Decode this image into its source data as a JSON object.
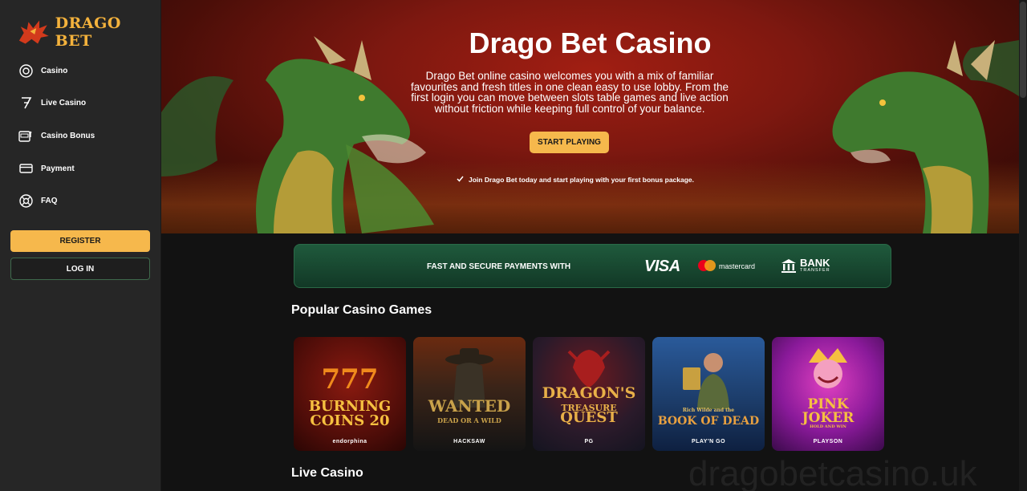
{
  "brand": {
    "name": "DRAGO BET",
    "accent": "#f6b84c",
    "logo_color": "#f4b23c"
  },
  "sidebar": {
    "items": [
      {
        "label": "Casino",
        "icon": "casino-chip-icon"
      },
      {
        "label": "Live Casino",
        "icon": "seven-icon"
      },
      {
        "label": "Casino Bonus",
        "icon": "slot-machine-icon"
      },
      {
        "label": "Payment",
        "icon": "card-icon"
      },
      {
        "label": "FAQ",
        "icon": "lifebuoy-icon"
      }
    ],
    "register_label": "REGISTER",
    "login_label": "LOG IN"
  },
  "hero": {
    "title": "Drago Bet Casino",
    "description": "Drago Bet online casino welcomes you with a mix of familiar favourites and fresh titles in one clean easy to use lobby. From the first login you can move between slots table games and live action without friction while keeping full control of your balance.",
    "cta_label": "START PLAYING",
    "note": "Join Drago Bet today and start playing with your first bonus package."
  },
  "payments": {
    "label": "FAST AND SECURE PAYMENTS WITH",
    "visa": "VISA",
    "mastercard": "mastercard",
    "bank_line1": "BANK",
    "bank_line2": "TRANSFER"
  },
  "popular": {
    "title": "Popular Casino Games",
    "games": [
      {
        "title": "BURNING COINS 20",
        "title_l1": "777",
        "title_l2": "BURNING",
        "title_l3": "COINS 20",
        "provider": "endorphina",
        "bg": "#4a0c08"
      },
      {
        "title": "WANTED DEAD OR A WILD",
        "title_l1": "WANTED",
        "title_l2": "DEAD OR A WILD",
        "provider": "HACKSAW",
        "bg": "#2a2018"
      },
      {
        "title": "DRAGON'S TREASURE QUEST",
        "title_l1": "DRAGON'S",
        "title_l2": "TREASURE",
        "title_l3": "QUEST",
        "provider": "PG",
        "bg": "#1e1c2a"
      },
      {
        "title": "BOOK OF DEAD",
        "title_l1": "Rich Wilde and the",
        "title_l2": "BOOK OF DEAD",
        "provider": "PLAY'N GO",
        "bg": "#1b3a66"
      },
      {
        "title": "PINK JOKER",
        "title_l1": "PINK",
        "title_l2": "JOKER",
        "title_l3": "HOLD AND WIN",
        "provider": "PLAYSON",
        "bg": "#6b1a7a"
      }
    ]
  },
  "live": {
    "title": "Live Casino"
  },
  "watermark": "dragobetcasino.uk"
}
